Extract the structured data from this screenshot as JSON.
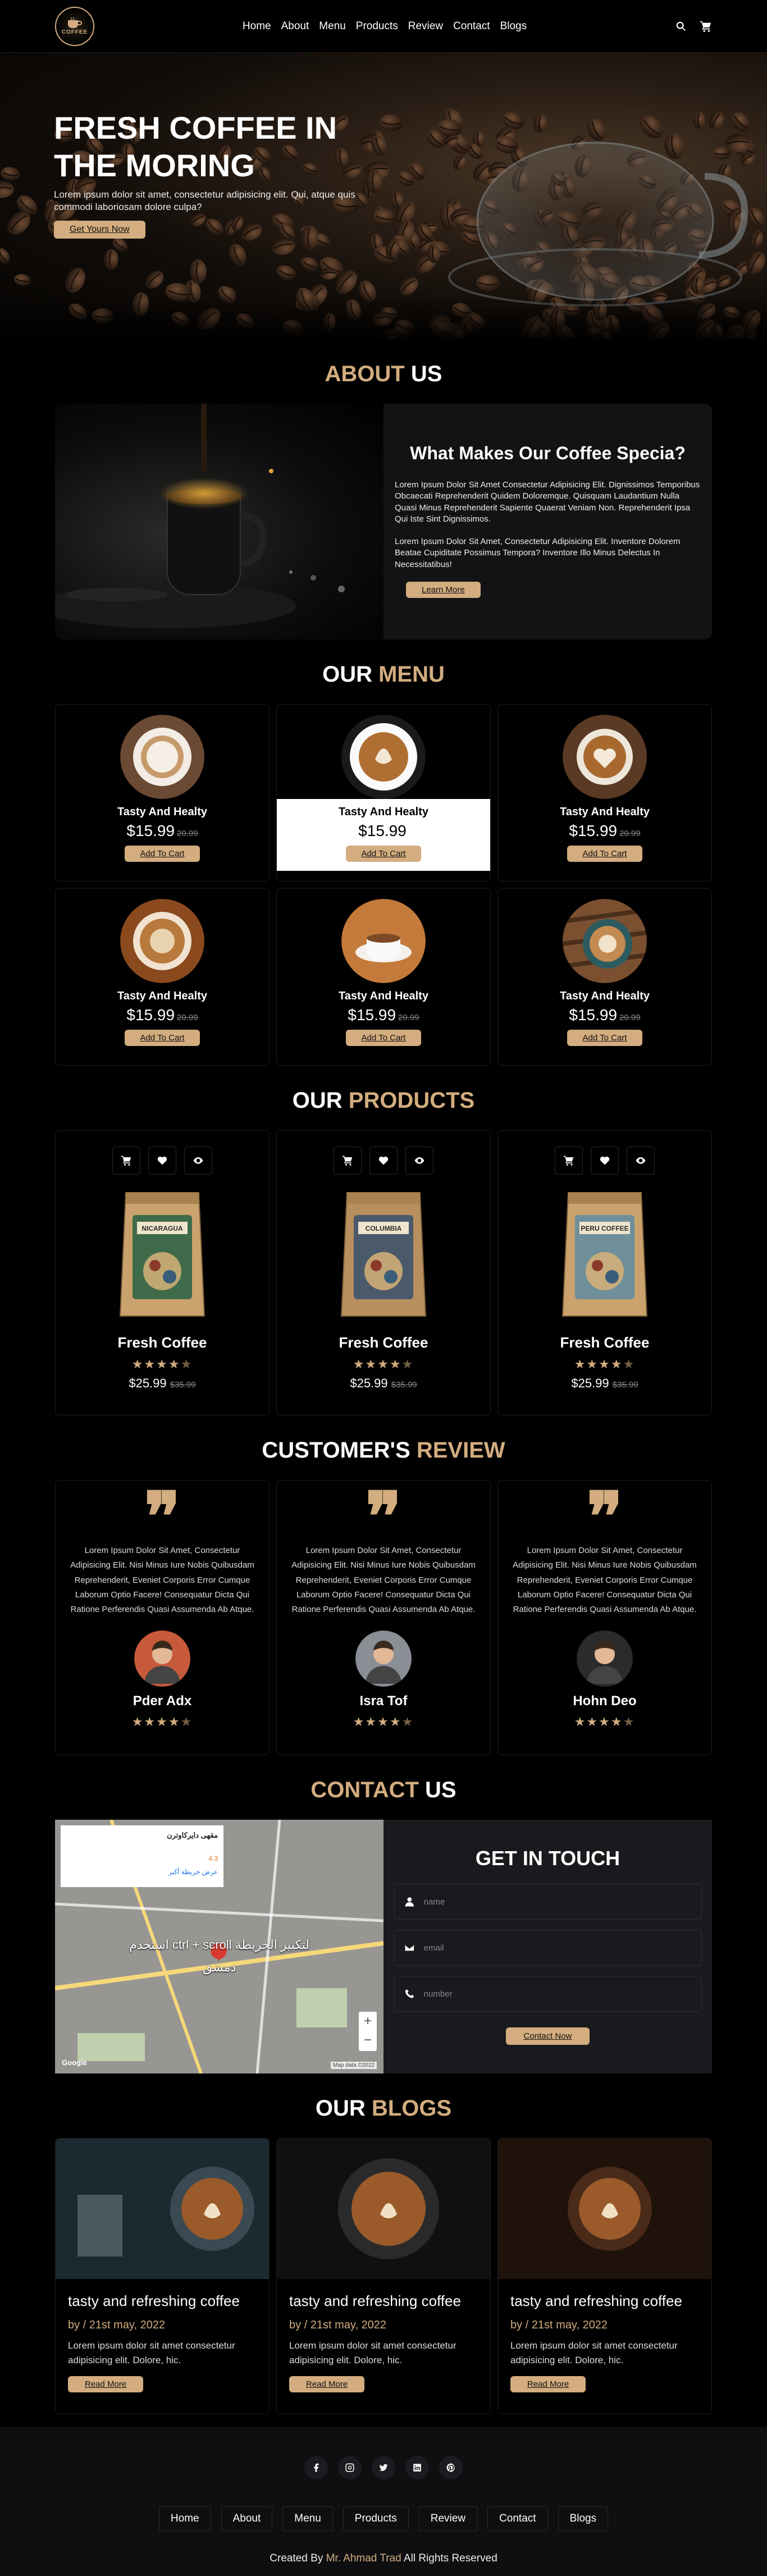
{
  "header": {
    "logo_text": "COFFEE",
    "nav": [
      "Home",
      "About",
      "Menu",
      "Products",
      "Review",
      "Contact",
      "Blogs"
    ],
    "icons": [
      "search-icon",
      "cart-icon"
    ]
  },
  "hero": {
    "title": "FRESH COFFEE IN THE MORING",
    "text": "Lorem ipsum dolor sit amet, consectetur adipisicing elit. Qui, atque quis commodi laboriosam dolore culpa?",
    "button": "Get Yours Now"
  },
  "about": {
    "title_accent": "ABOUT",
    "title_rest": "US",
    "heading": "What Makes Our Coffee Specia?",
    "p1": "Lorem Ipsum Dolor Sit Amet Consectetur Adipisicing Elit. Dignissimos Temporibus Obcaecati Reprehenderit Quidem Doloremque. Quisquam Laudantium Nulla Quasi Minus Reprehenderit Sapiente Quaerat Veniam Non. Reprehenderit Ipsa Qui Iste Sint Dignissimos.",
    "p2": "Lorem Ipsum Dolor Sit Amet, Consectetur Adipisicing Elit. Inventore Dolorem Beatae Cupiditate Possimus Tempora? Inventore Illo Minus Delectus In Necessitatibus!",
    "button": "Learn More"
  },
  "menu": {
    "title_rest": "OUR",
    "title_accent": "MENU",
    "items": [
      {
        "name": "Tasty And Healty",
        "price": "$15.99",
        "old": "20.99",
        "button": "Add To Cart"
      },
      {
        "name": "Tasty And Healty",
        "price": "$15.99",
        "old": "",
        "button": "Add To Cart"
      },
      {
        "name": "Tasty And Healty",
        "price": "$15.99",
        "old": "20.99",
        "button": "Add To Cart"
      },
      {
        "name": "Tasty And Healty",
        "price": "$15.99",
        "old": "20.99",
        "button": "Add To Cart"
      },
      {
        "name": "Tasty And Healty",
        "price": "$15.99",
        "old": "20.99",
        "button": "Add To Cart"
      },
      {
        "name": "Tasty And Healty",
        "price": "$15.99",
        "old": "20.99",
        "button": "Add To Cart"
      }
    ]
  },
  "products": {
    "title_rest": "OUR",
    "title_accent": "PRODUCTS",
    "items": [
      {
        "name": "Fresh Coffee",
        "price": "$25.99",
        "old": "$35.99",
        "label": "NICARAGUA",
        "rating": 4.5
      },
      {
        "name": "Fresh Coffee",
        "price": "$25.99",
        "old": "$35.99",
        "label": "COLUMBIA",
        "rating": 4.5
      },
      {
        "name": "Fresh Coffee",
        "price": "$25.99",
        "old": "$35.99",
        "label": "PERU COFFEE",
        "rating": 4.5
      }
    ]
  },
  "review": {
    "title_rest": "CUSTOMER'S",
    "title_accent": "REVIEW",
    "items": [
      {
        "text": "Lorem Ipsum Dolor Sit Amet, Consectetur Adipisicing Elit. Nisi Minus Iure Nobis Quibusdam Reprehenderit, Eveniet Corporis Error Cumque Laborum Optio Facere! Consequatur Dicta Qui Ratione Perferendis Quasi Assumenda Ab Atque.",
        "name": "Pder Adx",
        "rating": 4.5
      },
      {
        "text": "Lorem Ipsum Dolor Sit Amet, Consectetur Adipisicing Elit. Nisi Minus Iure Nobis Quibusdam Reprehenderit, Eveniet Corporis Error Cumque Laborum Optio Facere! Consequatur Dicta Qui Ratione Perferendis Quasi Assumenda Ab Atque.",
        "name": "Isra Tof",
        "rating": 4.5
      },
      {
        "text": "Lorem Ipsum Dolor Sit Amet, Consectetur Adipisicing Elit. Nisi Minus Iure Nobis Quibusdam Reprehenderit, Eveniet Corporis Error Cumque Laborum Optio Facere! Consequatur Dicta Qui Ratione Perferendis Quasi Assumenda Ab Atque.",
        "name": "Hohn Deo",
        "rating": 4.5
      }
    ]
  },
  "contact": {
    "title_accent": "CONTACT",
    "title_rest": "US",
    "heading": "GET IN TOUCH",
    "name_placeholder": "name",
    "email_placeholder": "email",
    "number_placeholder": "number",
    "button": "Contact Now",
    "map_overlay": "استخدم ctrl + scroll لتكبير الخريطة",
    "map_city": "دمشق",
    "map_card_title": "مقهى دايركاوترن",
    "map_card_rating": "4.3",
    "map_card_link": "عرض خريطة أكبر",
    "map_footer": "Map data ©2022",
    "map_brand": "Google"
  },
  "blogs": {
    "title_rest": "OUR",
    "title_accent": "BLOGS",
    "items": [
      {
        "title": "tasty and refreshing coffee",
        "date": "by / 21st may, 2022",
        "text": "Lorem ipsum dolor sit amet consectetur adipisicing elit. Dolore, hic.",
        "button": "Read More"
      },
      {
        "title": "tasty and refreshing coffee",
        "date": "by / 21st may, 2022",
        "text": "Lorem ipsum dolor sit amet consectetur adipisicing elit. Dolore, hic.",
        "button": "Read More"
      },
      {
        "title": "tasty and refreshing coffee",
        "date": "by / 21st may, 2022",
        "text": "Lorem ipsum dolor sit amet consectetur adipisicing elit. Dolore, hic.",
        "button": "Read More"
      }
    ]
  },
  "footer": {
    "socials": [
      "facebook-icon",
      "instagram-icon",
      "twitter-icon",
      "linkedin-icon",
      "pinterest-icon"
    ],
    "nav": [
      "Home",
      "About",
      "Menu",
      "Products",
      "Review",
      "Contact",
      "Blogs"
    ],
    "credit_pre": "Created By",
    "credit_name": "Mr. Ahmad Trad",
    "credit_post": "All Rights Reserved"
  },
  "colors": {
    "accent": "#d3ad7f",
    "background": "#000000",
    "panel": "#131316"
  }
}
